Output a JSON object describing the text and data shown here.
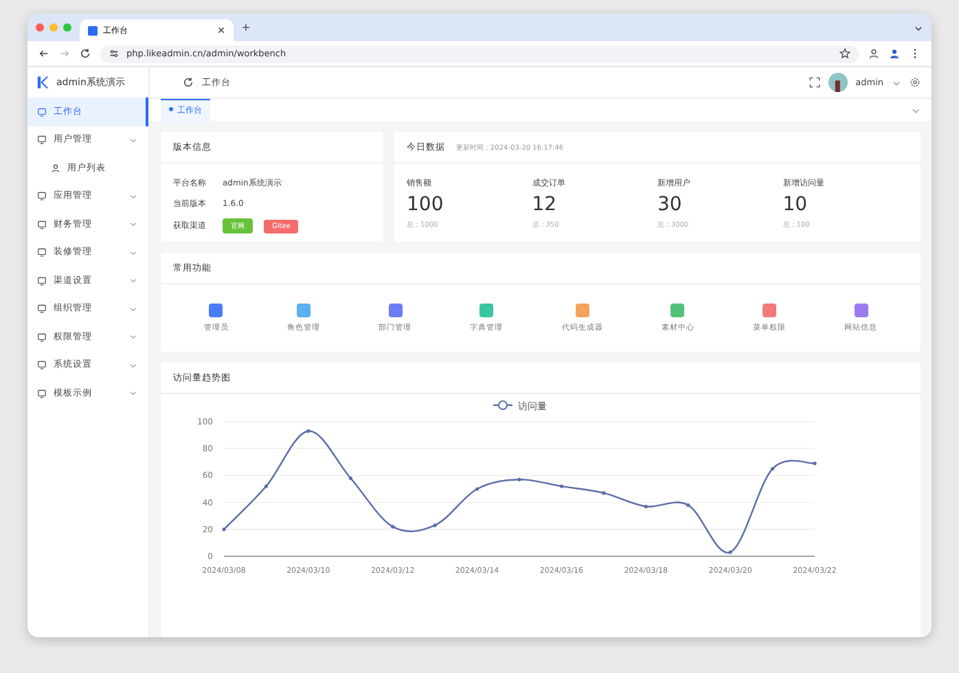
{
  "browser": {
    "tab_title": "工作台",
    "url": "php.likeadmin.cn/admin/workbench"
  },
  "sidebar": {
    "logo_text": "admin系统演示",
    "items": [
      {
        "label": "工作台",
        "selected": true,
        "expandable": false
      },
      {
        "label": "用户管理",
        "selected": false,
        "expandable": true,
        "children": [
          {
            "label": "用户列表",
            "selected": false
          }
        ]
      },
      {
        "label": "应用管理",
        "selected": false,
        "expandable": true
      },
      {
        "label": "财务管理",
        "selected": false,
        "expandable": true
      },
      {
        "label": "装修管理",
        "selected": false,
        "expandable": true
      },
      {
        "label": "渠道设置",
        "selected": false,
        "expandable": true
      },
      {
        "label": "组织管理",
        "selected": false,
        "expandable": true
      },
      {
        "label": "权限管理",
        "selected": false,
        "expandable": true
      },
      {
        "label": "系统设置",
        "selected": false,
        "expandable": true
      },
      {
        "label": "模板示例",
        "selected": false,
        "expandable": true
      }
    ]
  },
  "header": {
    "breadcrumb": "工作台",
    "user": "admin"
  },
  "tabs": [
    {
      "label": "工作台",
      "selected": true
    }
  ],
  "version_card": {
    "title": "版本信息",
    "rows": [
      {
        "label": "平台名称",
        "value": "admin系统演示"
      },
      {
        "label": "当前版本",
        "value": "1.6.0"
      }
    ],
    "channel_label": "获取渠道",
    "buttons": [
      {
        "label": "官网",
        "color": "#67c23a"
      },
      {
        "label": "Gitee",
        "color": "#f56c6c"
      }
    ]
  },
  "today_card": {
    "title": "今日数据",
    "updated": "更新时间：2024-03-20 16:17:46",
    "stats": [
      {
        "label": "销售额",
        "value": "100",
        "total": "总：1000"
      },
      {
        "label": "成交订单",
        "value": "12",
        "total": "总：350"
      },
      {
        "label": "新增用户",
        "value": "30",
        "total": "总：3000"
      },
      {
        "label": "新增访问量",
        "value": "10",
        "total": "总：100"
      }
    ]
  },
  "shortcuts": {
    "title": "常用功能",
    "items": [
      {
        "label": "管理员",
        "color": "#4a7cf6"
      },
      {
        "label": "角色管理",
        "color": "#5ab1ef"
      },
      {
        "label": "部门管理",
        "color": "#6b7cf6"
      },
      {
        "label": "字典管理",
        "color": "#36c6a0"
      },
      {
        "label": "代码生成器",
        "color": "#f5a25d"
      },
      {
        "label": "素材中心",
        "color": "#52c27a"
      },
      {
        "label": "菜单权限",
        "color": "#f27a7a"
      },
      {
        "label": "网站信息",
        "color": "#9b7cf0"
      }
    ]
  },
  "trend_card": {
    "title": "访问量趋势图",
    "chart_data": {
      "type": "line",
      "x": [
        "2024/03/08",
        null,
        "2024/03/10",
        null,
        "2024/03/12",
        null,
        "2024/03/14",
        null,
        "2024/03/16",
        null,
        "2024/03/18",
        null,
        "2024/03/20",
        null,
        "2024/03/22"
      ],
      "grid": true,
      "ylim": [
        0,
        100
      ],
      "yticks": [
        0,
        20,
        40,
        60,
        80,
        100
      ],
      "series": [
        {
          "name": "访问量",
          "color": "#5b6ea8",
          "values": [
            20,
            52,
            93,
            58,
            22,
            23,
            50,
            57,
            52,
            47,
            37,
            38,
            3,
            65,
            69
          ]
        }
      ]
    }
  }
}
